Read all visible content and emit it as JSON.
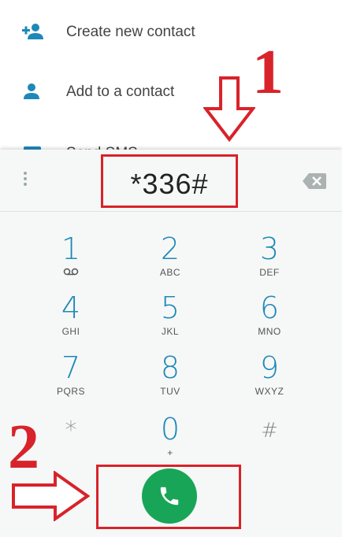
{
  "list": {
    "items": [
      {
        "label": "Create new contact",
        "icon": "add-person-icon"
      },
      {
        "label": "Add to a contact",
        "icon": "person-icon"
      },
      {
        "label": "Send SMS",
        "icon": "message-icon"
      }
    ]
  },
  "annotations": {
    "step1": "1",
    "step2": "2",
    "color": "#d8232a"
  },
  "dialer": {
    "digits": "*336#",
    "keys": [
      {
        "num": "1",
        "sub": ""
      },
      {
        "num": "2",
        "sub": "ABC"
      },
      {
        "num": "3",
        "sub": "DEF"
      },
      {
        "num": "4",
        "sub": "GHI"
      },
      {
        "num": "5",
        "sub": "JKL"
      },
      {
        "num": "6",
        "sub": "MNO"
      },
      {
        "num": "7",
        "sub": "PQRS"
      },
      {
        "num": "8",
        "sub": "TUV"
      },
      {
        "num": "9",
        "sub": "WXYZ"
      },
      {
        "num": "*",
        "sub": ""
      },
      {
        "num": "0",
        "sub": "+"
      },
      {
        "num": "#",
        "sub": ""
      }
    ],
    "call_color": "#19a558",
    "accent": "#1e88b8"
  }
}
